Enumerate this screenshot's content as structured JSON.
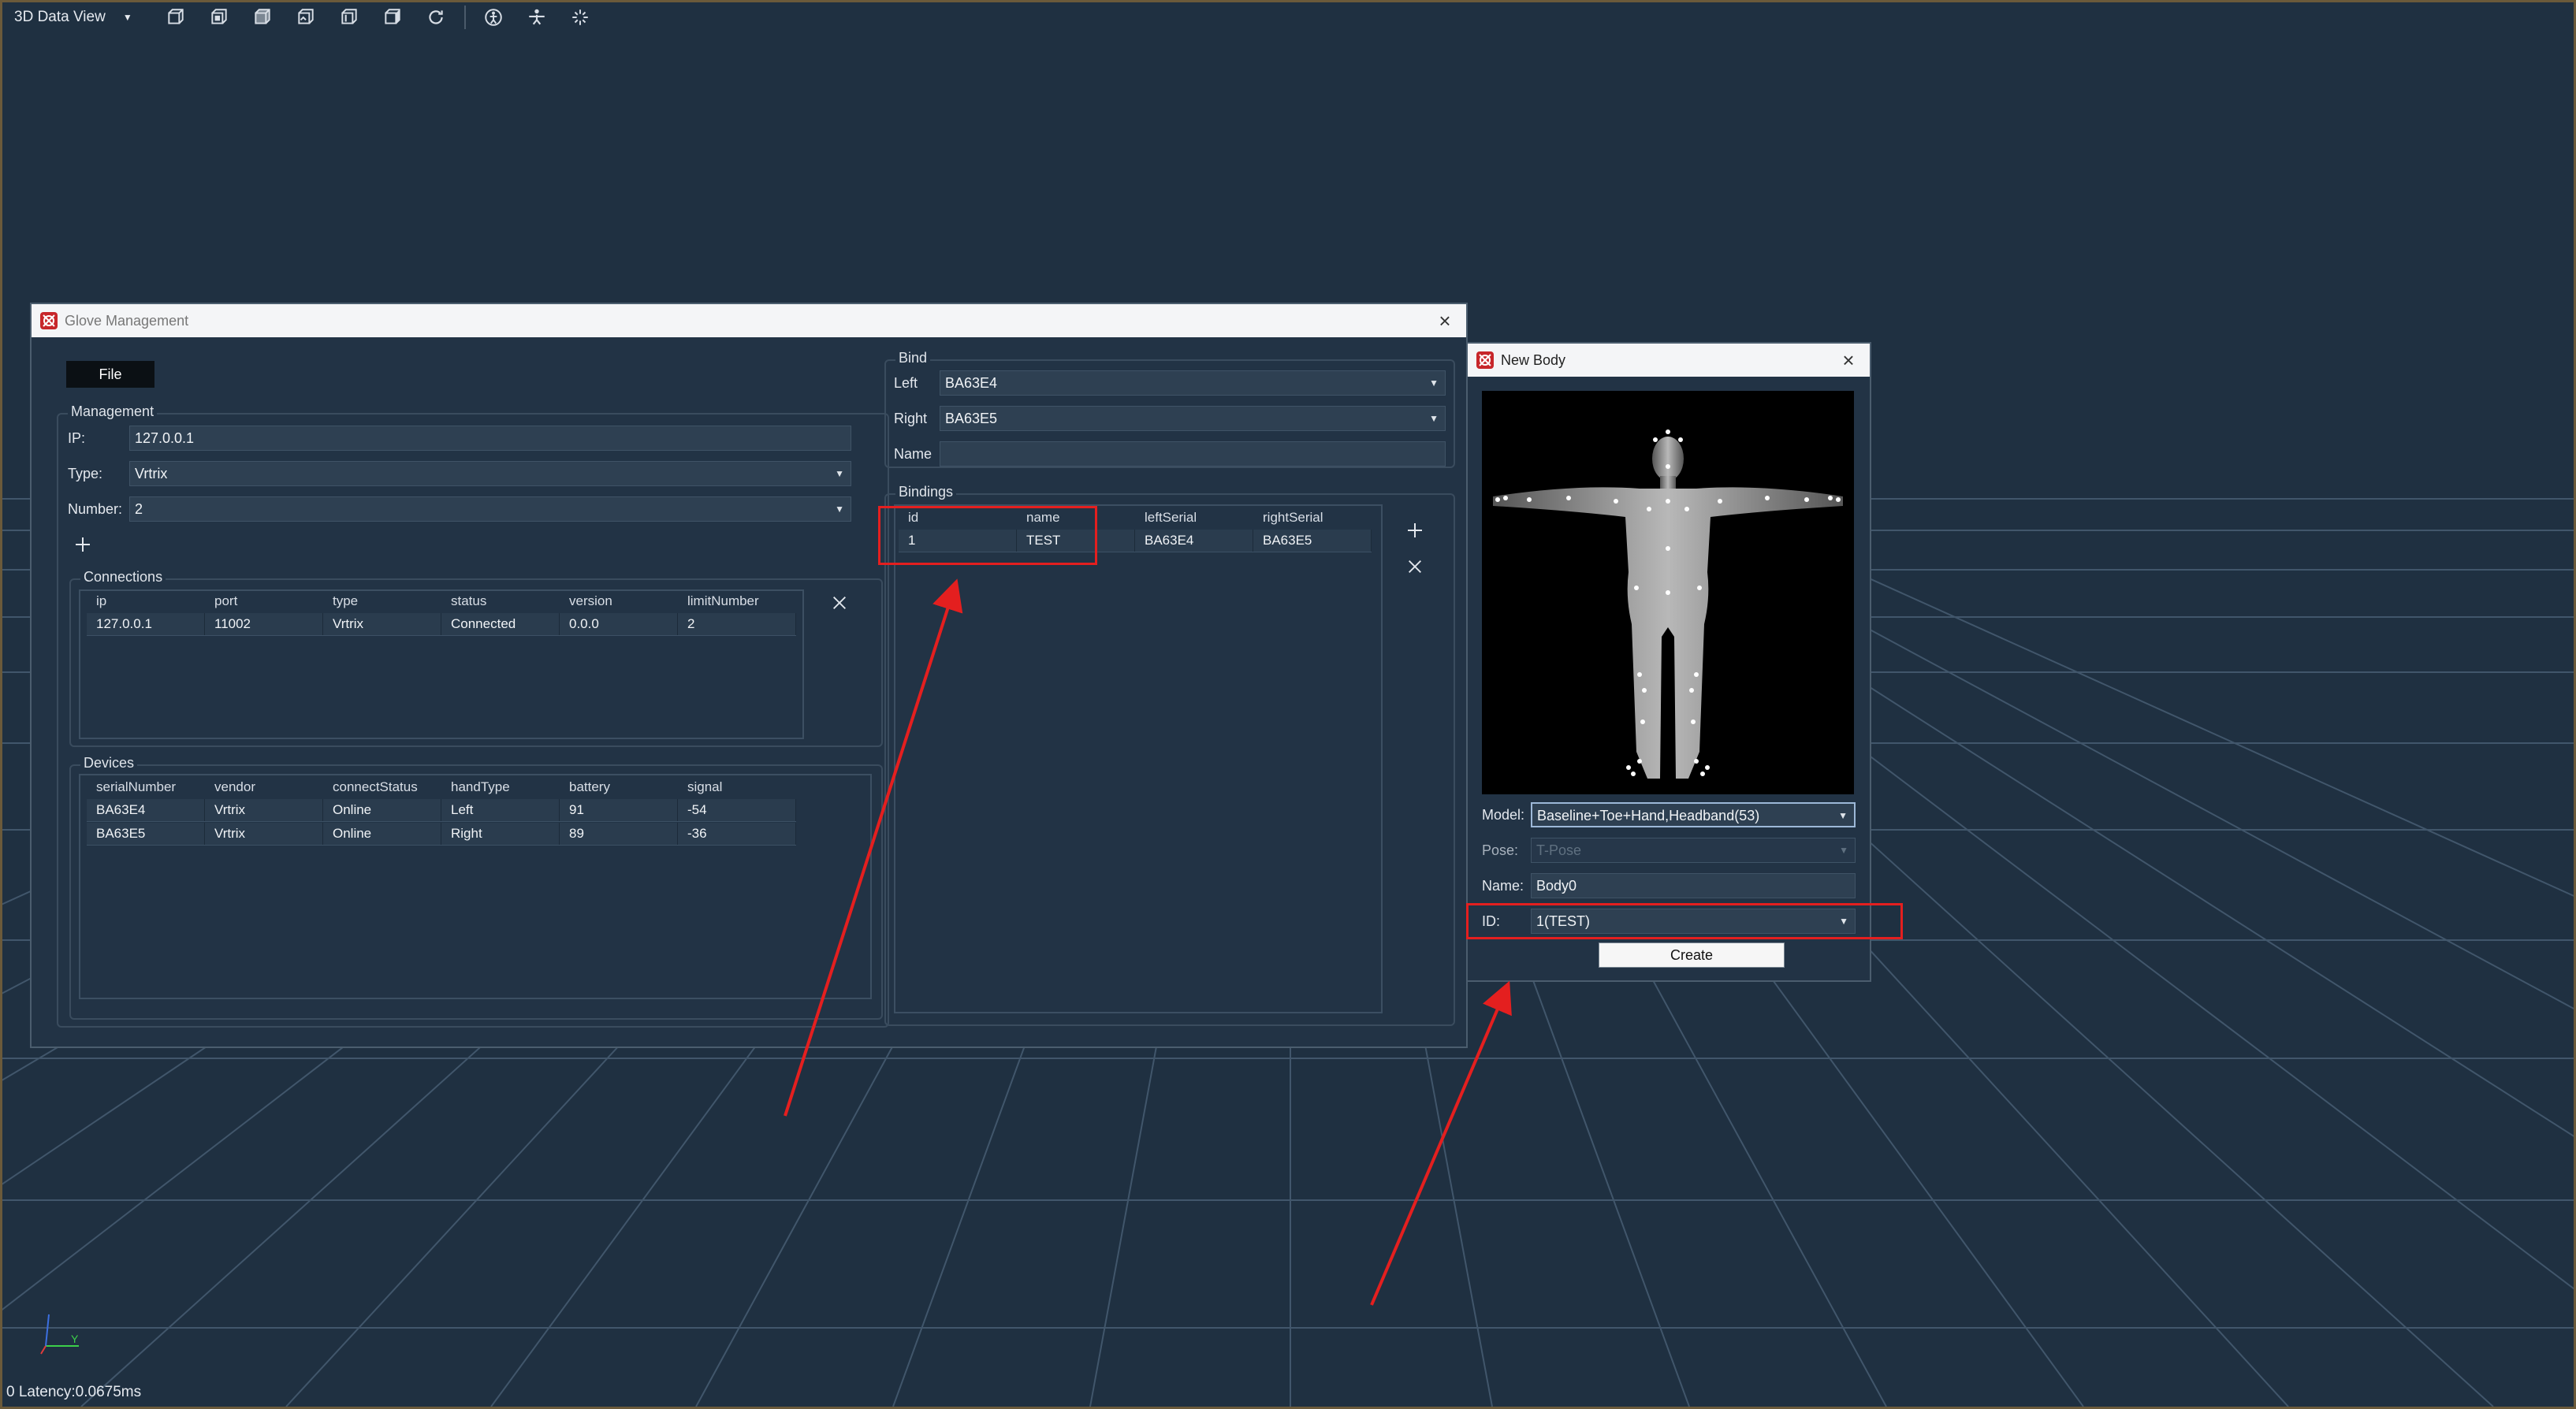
{
  "toolbar": {
    "view_mode": "3D Data View",
    "icons": [
      "cube-front-icon",
      "cube-back-icon",
      "cube-top-icon",
      "cube-bottom-icon",
      "cube-left-icon",
      "cube-right-icon",
      "refresh-icon",
      "skeleton-icon",
      "body-icon",
      "sparkle-icon"
    ]
  },
  "status": {
    "latency": "0 Latency:0.0675ms"
  },
  "axes": {
    "y": "Y"
  },
  "glove_window": {
    "title": "Glove Management",
    "file_menu": "File",
    "management": {
      "title": "Management",
      "ip_label": "IP:",
      "ip_value": "127.0.0.1",
      "type_label": "Type:",
      "type_value": "Vrtrix",
      "number_label": "Number:",
      "number_value": "2"
    },
    "connections": {
      "title": "Connections",
      "columns": [
        "ip",
        "port",
        "type",
        "status",
        "version",
        "limitNumber"
      ],
      "rows": [
        [
          "127.0.0.1",
          "11002",
          "Vrtrix",
          "Connected",
          "0.0.0",
          "2"
        ]
      ]
    },
    "devices": {
      "title": "Devices",
      "columns": [
        "serialNumber",
        "vendor",
        "connectStatus",
        "handType",
        "battery",
        "signal"
      ],
      "rows": [
        [
          "BA63E4",
          "Vrtrix",
          "Online",
          "Left",
          "91",
          "-54"
        ],
        [
          "BA63E5",
          "Vrtrix",
          "Online",
          "Right",
          "89",
          "-36"
        ]
      ]
    },
    "bind": {
      "title": "Bind",
      "left_label": "Left",
      "left_value": "BA63E4",
      "right_label": "Right",
      "right_value": "BA63E5",
      "name_label": "Name",
      "name_value": ""
    },
    "bindings": {
      "title": "Bindings",
      "columns": [
        "id",
        "name",
        "leftSerial",
        "rightSerial"
      ],
      "rows": [
        [
          "1",
          "TEST",
          "BA63E4",
          "BA63E5"
        ]
      ]
    }
  },
  "new_body_window": {
    "title": "New Body",
    "model_label": "Model:",
    "model_value": "Baseline+Toe+Hand,Headband(53)",
    "pose_label": "Pose:",
    "pose_value": "T-Pose",
    "name_label": "Name:",
    "name_value": "Body0",
    "id_label": "ID:",
    "id_value": "1(TEST)",
    "create_label": "Create"
  },
  "colors": {
    "annotation": "#e41f1f",
    "background": "#1f3041",
    "panel": "#223345"
  }
}
